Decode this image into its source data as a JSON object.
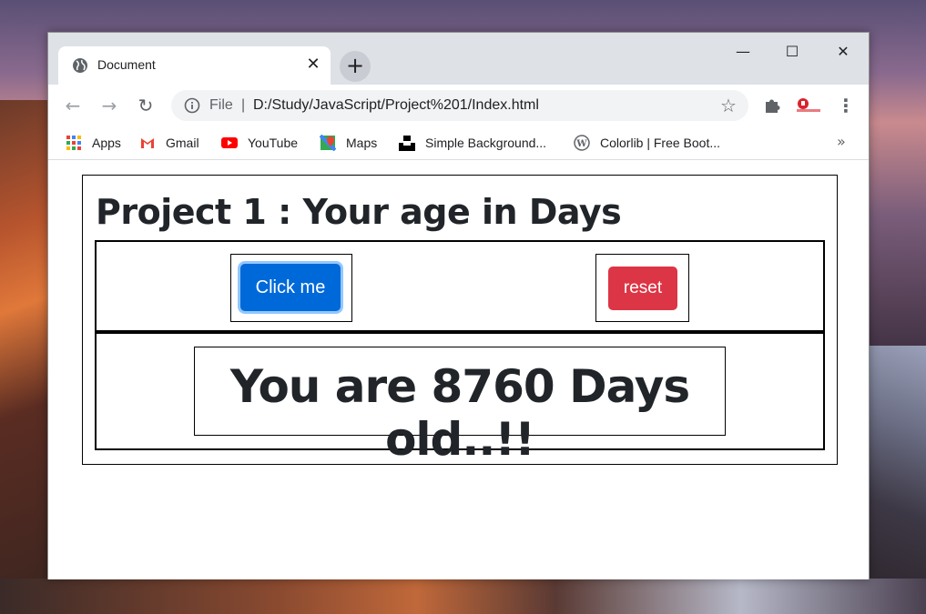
{
  "browser": {
    "tab": {
      "title": "Document",
      "close_glyph": "✕"
    },
    "new_tab_glyph": "+",
    "window_controls": {
      "minimize": "—",
      "maximize": "☐",
      "close": "✕"
    },
    "nav": {
      "back": "←",
      "forward": "→",
      "reload": "↻"
    },
    "omnibox": {
      "scheme_label": "File",
      "separator": "|",
      "url": "D:/Study/JavaScript/Project%201/Index.html",
      "star": "☆"
    },
    "menu_glyph": "⋮",
    "bookmarks": [
      {
        "label": "Apps",
        "icon": "apps-grid-icon"
      },
      {
        "label": "Gmail",
        "icon": "gmail-icon"
      },
      {
        "label": "YouTube",
        "icon": "youtube-icon"
      },
      {
        "label": "Maps",
        "icon": "maps-icon"
      },
      {
        "label": "Simple Background...",
        "icon": "unsplash-icon"
      },
      {
        "label": "Colorlib | Free Boot...",
        "icon": "wordpress-icon"
      }
    ],
    "bookmarks_more": "»"
  },
  "page": {
    "title": "Project 1 : Your age in Days",
    "click_button": "Click me",
    "reset_button": "reset",
    "result": "You are 8760 Days old..!!"
  },
  "colors": {
    "primary": "#0069d9",
    "danger": "#dc3545",
    "text": "#212529"
  }
}
